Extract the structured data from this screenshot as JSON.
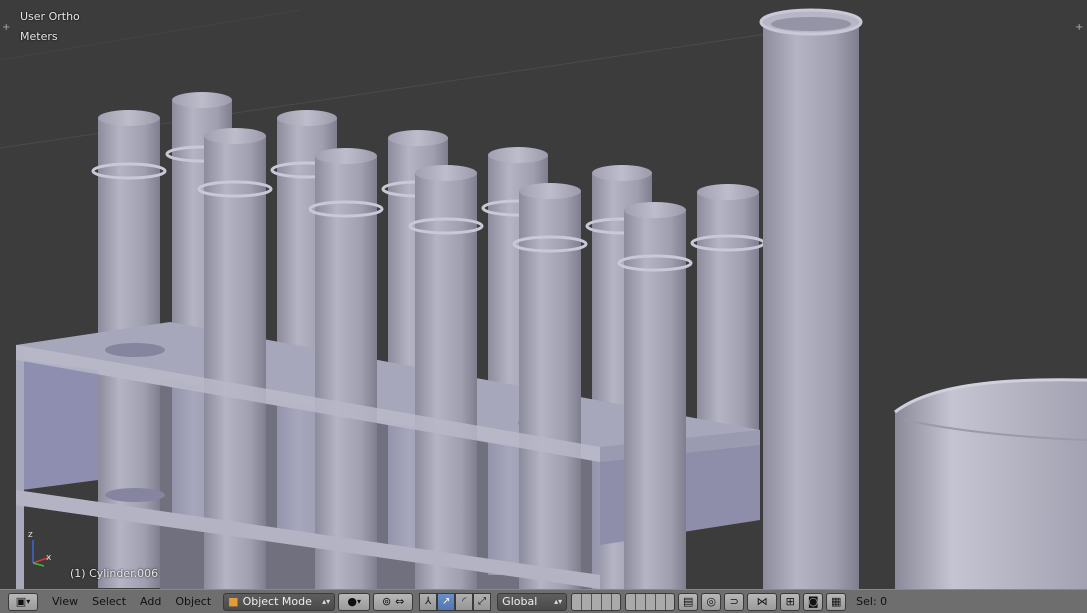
{
  "viewport": {
    "view_label": "User Ortho",
    "units_label": "Meters",
    "active_object_label": "(1) Cylinder.006"
  },
  "toolbar": {
    "menus": [
      "View",
      "Select",
      "Add",
      "Object"
    ],
    "mode": "Object Mode",
    "orientation": "Global",
    "selection_status": "Sel: 0"
  },
  "icons": {
    "editor_type": "cube-icon",
    "mode": "orange-cube-icon",
    "shading": "solid-sphere-icon",
    "pivot": "pivot-point-icon",
    "manipulator": "manipulator-axes-icon",
    "translate": "translate-arrow-icon",
    "rotate": "rotate-arc-icon",
    "scale": "scale-arrow-icon",
    "snap": "magnet-icon",
    "render": "camera-icon"
  },
  "colors": {
    "viewport_bg": "#3c3c3c",
    "mesh": "#a4a4b4",
    "mesh_shadow": "#8a8a9a",
    "rack_side": "#9898b4",
    "header_bg": "#6e6e6e",
    "active_button": "#5277b0"
  }
}
